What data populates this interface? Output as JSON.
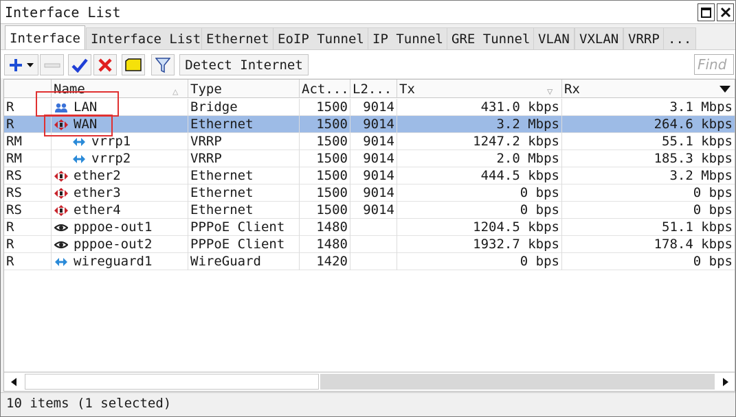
{
  "window": {
    "title": "Interface List"
  },
  "tabs": [
    {
      "label": "Interface",
      "active": true
    },
    {
      "label": "Interface List"
    },
    {
      "label": "Ethernet"
    },
    {
      "label": "EoIP Tunnel"
    },
    {
      "label": "IP Tunnel"
    },
    {
      "label": "GRE Tunnel"
    },
    {
      "label": "VLAN"
    },
    {
      "label": "VXLAN"
    },
    {
      "label": "VRRP"
    },
    {
      "label": "..."
    }
  ],
  "toolbar": {
    "detect_label": "Detect Internet",
    "find_placeholder": "Find"
  },
  "table": {
    "columns": [
      "",
      "Name",
      "Type",
      "Act...",
      "L2...",
      "Tx",
      "Rx"
    ],
    "rows": [
      {
        "flags": "R",
        "name": "LAN",
        "icon": "bridge-icon",
        "type": "Bridge",
        "actual_mtu": "1500",
        "l2_mtu": "9014",
        "tx": "431.0 kbps",
        "rx": "3.1 Mbps"
      },
      {
        "flags": "R",
        "name": "WAN",
        "icon": "ethernet-icon",
        "type": "Ethernet",
        "actual_mtu": "1500",
        "l2_mtu": "9014",
        "tx": "3.2 Mbps",
        "rx": "264.6 kbps",
        "selected": true
      },
      {
        "flags": "RM",
        "name": "vrrp1",
        "icon": "vrrp-icon",
        "type": "VRRP",
        "actual_mtu": "1500",
        "l2_mtu": "9014",
        "tx": "1247.2 kbps",
        "rx": "55.1 kbps"
      },
      {
        "flags": "RM",
        "name": "vrrp2",
        "icon": "vrrp-icon",
        "type": "VRRP",
        "actual_mtu": "1500",
        "l2_mtu": "9014",
        "tx": "2.0 Mbps",
        "rx": "185.3 kbps"
      },
      {
        "flags": "RS",
        "name": "ether2",
        "icon": "ethernet-icon",
        "type": "Ethernet",
        "actual_mtu": "1500",
        "l2_mtu": "9014",
        "tx": "444.5 kbps",
        "rx": "3.2 Mbps"
      },
      {
        "flags": "RS",
        "name": "ether3",
        "icon": "ethernet-icon",
        "type": "Ethernet",
        "actual_mtu": "1500",
        "l2_mtu": "9014",
        "tx": "0 bps",
        "rx": "0 bps"
      },
      {
        "flags": "RS",
        "name": "ether4",
        "icon": "ethernet-icon",
        "type": "Ethernet",
        "actual_mtu": "1500",
        "l2_mtu": "9014",
        "tx": "0 bps",
        "rx": "0 bps"
      },
      {
        "flags": "R",
        "name": "pppoe-out1",
        "icon": "pppoe-icon",
        "type": "PPPoE Client",
        "actual_mtu": "1480",
        "l2_mtu": "",
        "tx": "1204.5 kbps",
        "rx": "51.1 kbps"
      },
      {
        "flags": "R",
        "name": "pppoe-out2",
        "icon": "pppoe-icon",
        "type": "PPPoE Client",
        "actual_mtu": "1480",
        "l2_mtu": "",
        "tx": "1932.7 kbps",
        "rx": "178.4 kbps"
      },
      {
        "flags": "R",
        "name": "wireguard1",
        "icon": "wireguard-icon",
        "type": "WireGuard",
        "actual_mtu": "1420",
        "l2_mtu": "",
        "tx": "0 bps",
        "rx": "0 bps"
      }
    ]
  },
  "status": {
    "text": "10 items (1 selected)"
  },
  "colors": {
    "selected_row": "#9dbbe6",
    "highlight": "#e03030",
    "add": "#1f4fd6",
    "remove": "#e02020"
  }
}
